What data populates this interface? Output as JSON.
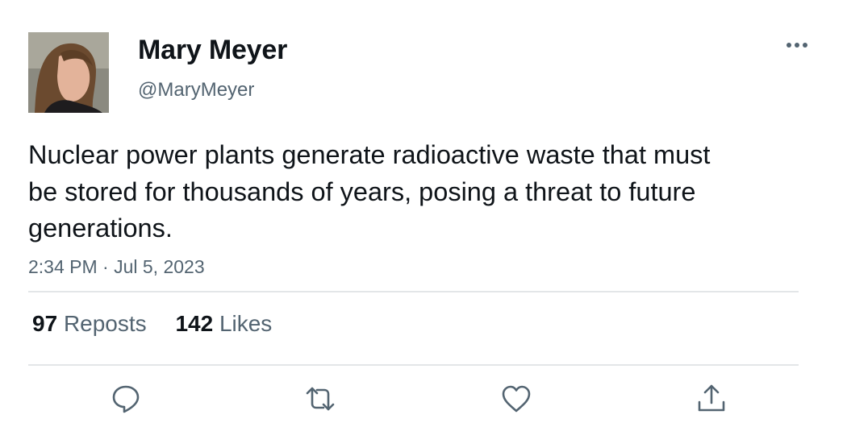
{
  "author": {
    "display_name": "Mary Meyer",
    "handle": "@MaryMeyer",
    "avatar_icon": "profile-photo"
  },
  "tweet": {
    "text": "Nuclear power plants generate radioactive waste that must be stored for thousands of years, posing a threat to future generations.",
    "timestamp": "2:34 PM · Jul 5, 2023"
  },
  "stats": {
    "reposts_count": "97",
    "reposts_label": "Reposts",
    "likes_count": "142",
    "likes_label": "Likes"
  },
  "actions": [
    "reply-icon",
    "repost-icon",
    "like-icon",
    "share-icon"
  ],
  "colors": {
    "text_primary": "#0f1419",
    "text_secondary": "#536471",
    "divider": "#e3e6e8",
    "icon": "#536471"
  }
}
